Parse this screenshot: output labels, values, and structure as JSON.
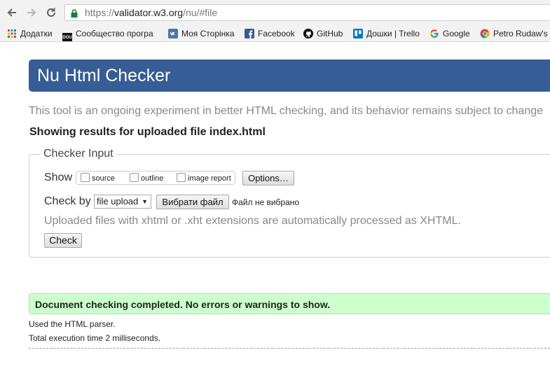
{
  "browser": {
    "url_scheme": "https://",
    "url_host": "validator.w3.org",
    "url_path": "/nu/#file",
    "bookmarks": [
      {
        "label": "Додатки",
        "icon": "apps-grid-icon"
      },
      {
        "label": "Сообщество програ",
        "icon": "dou-icon"
      },
      {
        "label": "Моя Сторінка",
        "icon": "vk-icon"
      },
      {
        "label": "Facebook",
        "icon": "facebook-icon"
      },
      {
        "label": "GitHub",
        "icon": "github-icon"
      },
      {
        "label": "Дошки | Trello",
        "icon": "trello-icon"
      },
      {
        "label": "Google",
        "icon": "google-icon"
      },
      {
        "label": "Petro Rudaw's",
        "icon": "chrome-icon"
      }
    ],
    "dou_icon_text": "DOU"
  },
  "page": {
    "title": "Nu Html Checker",
    "intro": "This tool is an ongoing experiment in better HTML checking, and its behavior remains subject to change",
    "results_heading": "Showing results for uploaded file index.html",
    "form": {
      "legend": "Checker Input",
      "show_label": "Show",
      "checkboxes": [
        {
          "label": "source",
          "checked": false
        },
        {
          "label": "outline",
          "checked": false
        },
        {
          "label": "image report",
          "checked": false
        }
      ],
      "options_button": "Options…",
      "check_by_label": "Check by",
      "check_by_value": "file upload",
      "file_button": "Вибрати файл",
      "no_file_text": "Файл не вибрано",
      "note": "Uploaded files with xhtml or .xht extensions are automatically processed as XHTML.",
      "check_button": "Check"
    },
    "success_message": "Document checking completed. No errors or warnings to show.",
    "parser_info": "Used the HTML parser.",
    "execution_time": "Total execution time 2 milliseconds."
  },
  "colors": {
    "banner": "#365d95",
    "success_bg": "#ccffcc"
  }
}
